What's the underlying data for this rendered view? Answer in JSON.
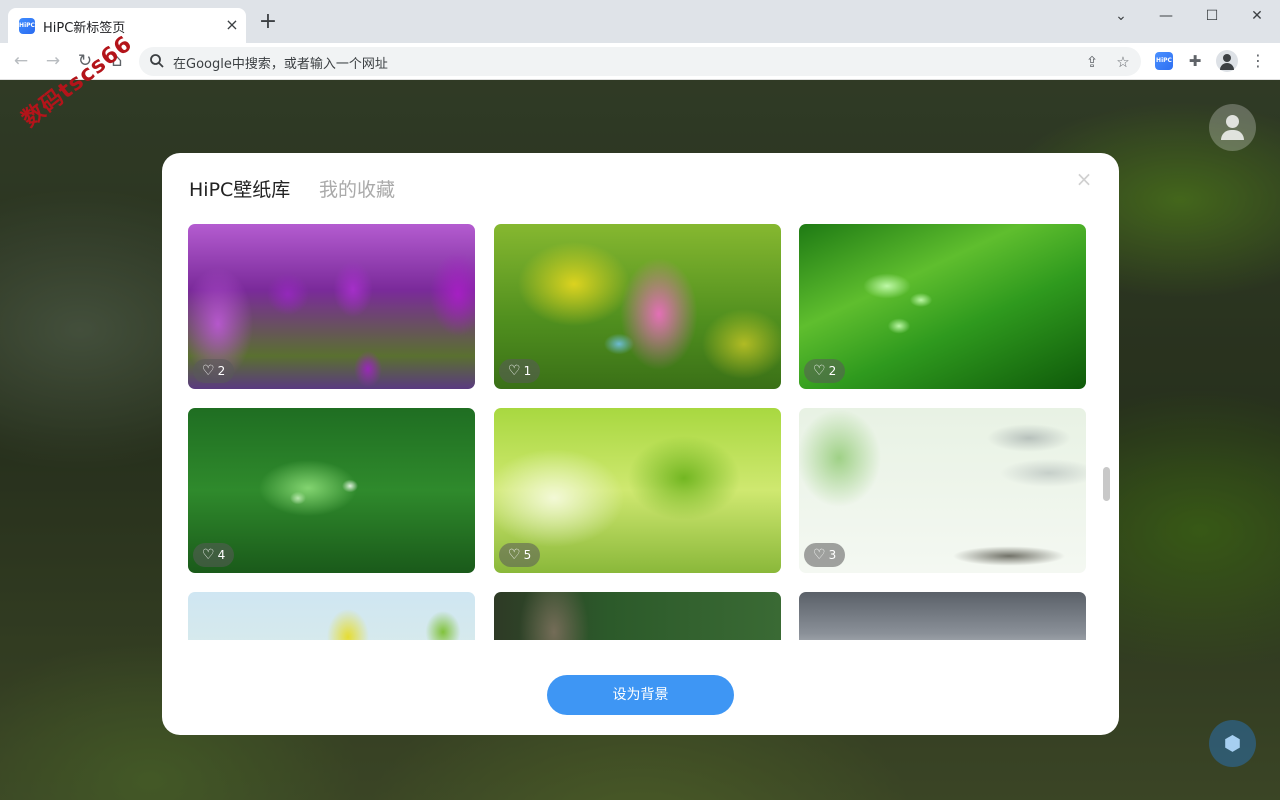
{
  "browser": {
    "tab_title": "HiPC新标签页",
    "favicon_label": "HiPC",
    "tab_close_icon": "×",
    "new_tab_icon": "+",
    "window": {
      "dropdown": "⌄",
      "minimize": "—",
      "maximize": "☐",
      "close": "✕"
    },
    "nav": {
      "back": "←",
      "forward": "→",
      "reload": "↻",
      "home": "⌂"
    },
    "omnibox_text": "在Google中搜索，或者输入一个网址",
    "share_icon": "⇪",
    "bookmark_icon": "☆",
    "extension_label": "HiPC",
    "puzzle_icon": "✚",
    "menu_icon": "⋮"
  },
  "watermark": "数码tscs66",
  "page": {
    "settings_icon": "⬢"
  },
  "dialog": {
    "tabs": [
      {
        "label": "HiPC壁纸库",
        "active": true
      },
      {
        "label": "我的收藏",
        "active": false
      }
    ],
    "close_icon": "×",
    "heart_icon": "♡",
    "wallpapers": [
      {
        "name": "purple-tulips",
        "likes": "2"
      },
      {
        "name": "pink-lupine-butterfly",
        "likes": "1"
      },
      {
        "name": "leaf-water-drops",
        "likes": "2"
      },
      {
        "name": "dew-leaf",
        "likes": "4"
      },
      {
        "name": "ginkgo-leaves",
        "likes": "5"
      },
      {
        "name": "ink-wash-village",
        "likes": "3"
      },
      {
        "name": "yellow-leaf",
        "likes": ""
      },
      {
        "name": "forest-trunk",
        "likes": ""
      },
      {
        "name": "mountain-clouds",
        "likes": ""
      }
    ],
    "set_background_label": "设为背景"
  }
}
